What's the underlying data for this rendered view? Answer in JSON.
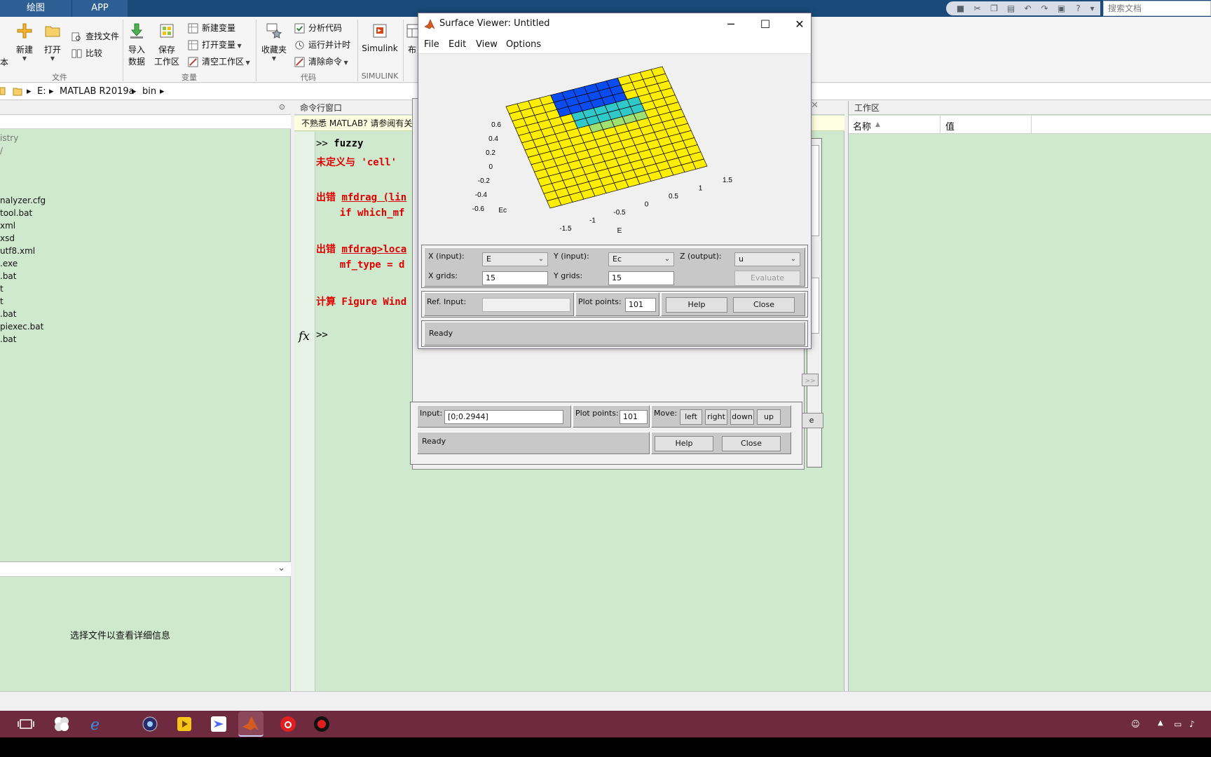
{
  "ribbon": {
    "tabs": [
      "绘图",
      "APP"
    ],
    "search_placeholder": "搜索文档",
    "new_label": "新建",
    "open_label": "打开",
    "find_files": "查找文件",
    "compare": "比较",
    "import_label_1": "导入",
    "import_label_2": "数据",
    "save_ws_1": "保存",
    "save_ws_2": "工作区",
    "new_var": "新建变量",
    "open_var": "打开变量",
    "clear_ws": "清空工作区",
    "favorites": "收藏夹",
    "analyze_code": "分析代码",
    "run_time": "运行并计时",
    "clear_cmd": "清除命令",
    "simulink": "Simulink",
    "layout_partial": "布",
    "group_file": "文件",
    "group_var": "变量",
    "group_code": "代码",
    "group_simulink": "SIMULINK",
    "left_edge_label": "本"
  },
  "address": {
    "parts": [
      "E:",
      "MATLAB R2019a",
      "bin"
    ]
  },
  "left_panel": {
    "files": [
      "istry",
      "/",
      "nalyzer.cfg",
      "tool.bat",
      "xml",
      "xsd",
      "utf8.xml",
      ".exe",
      ".bat",
      "t",
      "t",
      ".bat",
      "piexec.bat",
      ".bat"
    ],
    "detail_text": "选择文件以查看详细信息"
  },
  "command_window": {
    "title": "命令行窗口",
    "notice": "不熟悉 MATLAB? 请参阅有关",
    "prompt_fx": "fx",
    "lines": {
      "l1_prompt": ">> ",
      "l1_cmd": "fuzzy",
      "l2": "未定义与 'cell'",
      "l3_prefix": "出错 ",
      "l3_link": "mfdrag",
      "l3_rest": " (lin",
      "l4": "    if which_mf",
      "l5_prefix": "出错 ",
      "l5_link": "mfdrag>loca",
      "l6": "    mf_type = d",
      "l7": "计算 Figure Wind",
      "l8": ">>"
    }
  },
  "workspace": {
    "title": "工作区",
    "col_name": "名称",
    "col_value": "值"
  },
  "surface_viewer": {
    "title": "Surface Viewer: Untitled",
    "menu": [
      "File",
      "Edit",
      "View",
      "Options"
    ],
    "plot": {
      "y_ticks": [
        "0.6",
        "0.4",
        "0.2",
        "0",
        "-0.2",
        "-0.4",
        "-0.6"
      ],
      "x_ticks": [
        "-1.5",
        "-1",
        "-0.5",
        "0",
        "0.5",
        "1",
        "1.5"
      ],
      "x_label": "E",
      "y_label": "Ec"
    },
    "x_input_label": "X (input):",
    "x_input_value": "E",
    "y_input_label": "Y (input):",
    "y_input_value": "Ec",
    "z_output_label": "Z (output):",
    "z_output_value": "u",
    "x_grids_label": "X grids:",
    "x_grids_value": "15",
    "y_grids_label": "Y grids:",
    "y_grids_value": "15",
    "evaluate": "Evaluate",
    "ref_input_label": "Ref. Input:",
    "plot_points_label": "Plot points:",
    "plot_points_value": "101",
    "help": "Help",
    "close": "Close",
    "status": "Ready"
  },
  "rule_viewer": {
    "input_label": "Input:",
    "input_value": "[0;0.2944]",
    "plot_points_label": "Plot points:",
    "plot_points_value": "101",
    "move_label": "Move:",
    "left": "left",
    "right": "right",
    "down": "down",
    "up": "up",
    "status": "Ready",
    "help": "Help",
    "close": "Close",
    "partial_btn": "e",
    "partial_btn2": ">>"
  },
  "colors": {
    "surface_yellow": "#ffee00",
    "surface_blue": "#0a4cf0",
    "surface_cyan": "#30c8c8",
    "taskbar": "#6e2b3f",
    "panel_green": "#cfe9cf",
    "error_red": "#e00000"
  }
}
